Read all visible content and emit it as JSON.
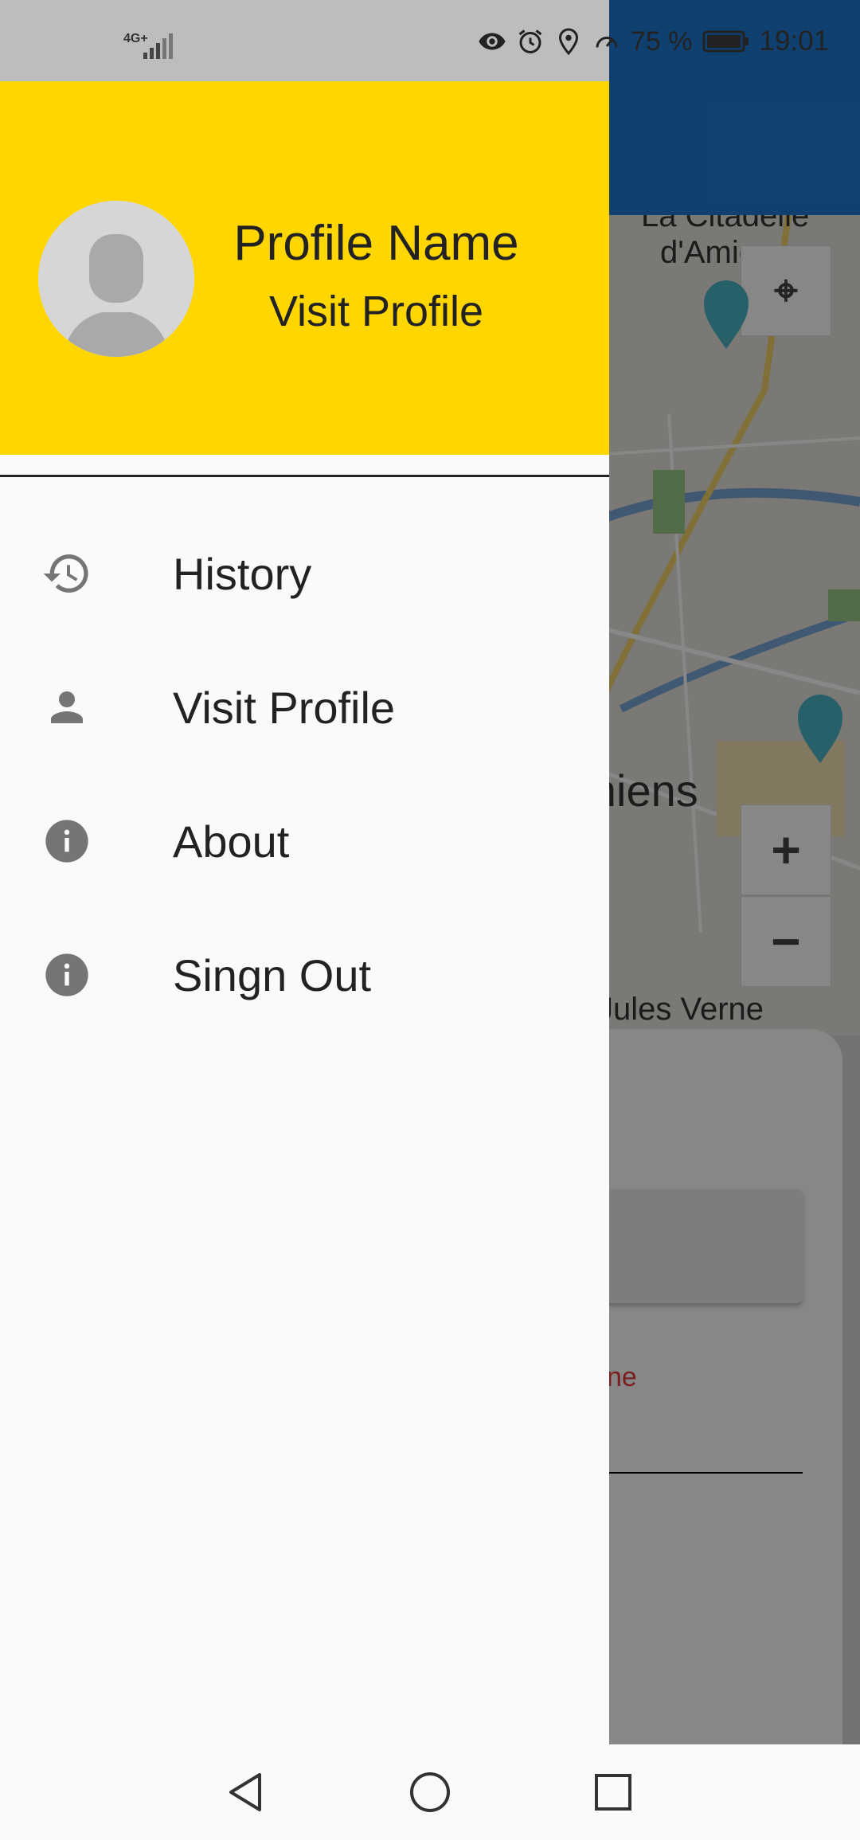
{
  "status_bar": {
    "network": "4G+",
    "battery": "75 %",
    "time": "19:01",
    "icons": [
      "signal-icon",
      "eye-icon",
      "alarm-icon",
      "location-icon",
      "speedometer-icon",
      "battery-icon"
    ]
  },
  "drawer": {
    "header": {
      "profile_name": "Profile Name",
      "visit_profile": "Visit Profile",
      "avatar_icon": "person-placeholder-icon"
    },
    "items": [
      {
        "label": "History",
        "icon": "history-icon"
      },
      {
        "label": "Visit Profile",
        "icon": "person-icon"
      },
      {
        "label": "About",
        "icon": "info-icon"
      },
      {
        "label": "Singn Out",
        "icon": "info-icon"
      }
    ]
  },
  "background": {
    "map_labels": {
      "citadelle": "La Citadelle\nd'Amiens",
      "city": "Amiens",
      "poi": "Jules Verne"
    },
    "zoom_in": "+",
    "zoom_out": "−",
    "sheet_link": "ne"
  },
  "colors": {
    "header": "#ffd600",
    "app_bar": "#1f7ad1",
    "drawer_bg": "#fafafa",
    "icon_gray": "#757575"
  },
  "nav_bar": {
    "buttons": [
      "back-icon",
      "home-icon",
      "recents-icon"
    ]
  }
}
